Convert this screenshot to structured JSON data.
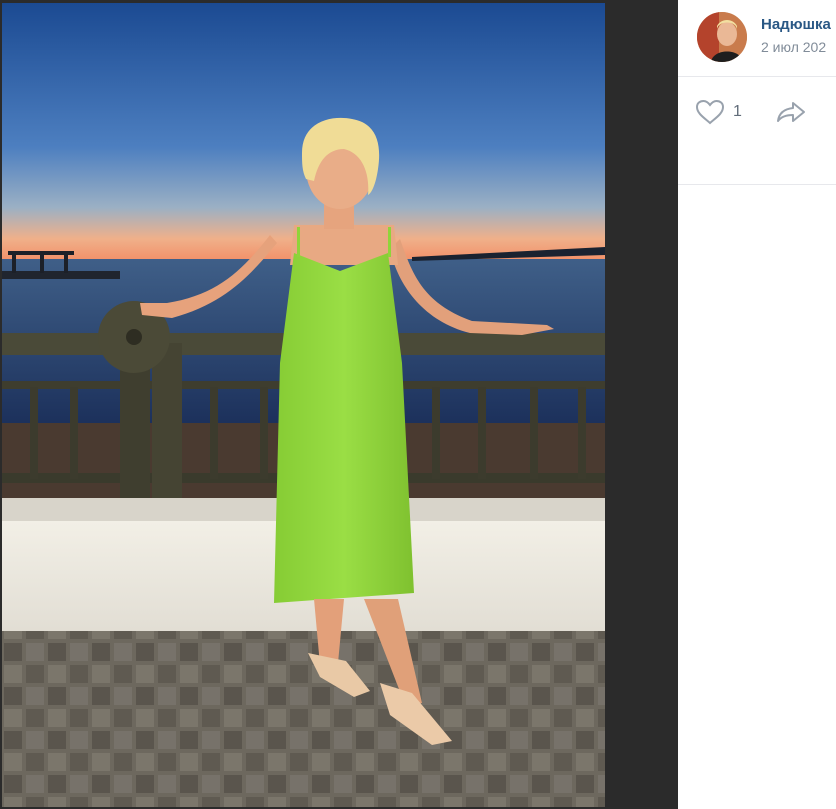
{
  "post": {
    "author_name": "Надюшка",
    "date": "2 июл 202",
    "likes_count": "1"
  },
  "icons": {
    "like": "heart-outline-icon",
    "share": "share-arrow-icon"
  },
  "colors": {
    "author_link": "#2a5885",
    "meta_text": "#818c99",
    "dress": "#8fd43a",
    "sky_top": "#1e4f95",
    "sunset": "#f5a07a"
  }
}
